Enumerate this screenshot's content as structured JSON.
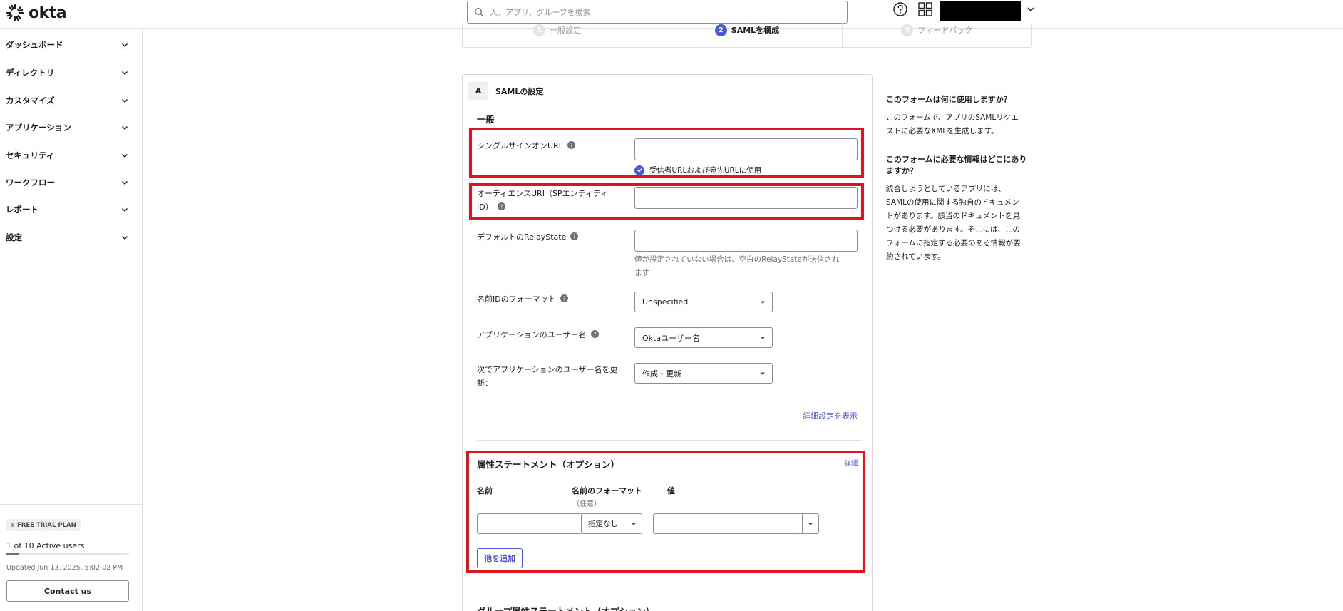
{
  "app": {
    "brand": "okta"
  },
  "search": {
    "placeholder": "人、アプリ、グループを検索"
  },
  "sidebar": {
    "items": [
      {
        "label": "ダッシュボード"
      },
      {
        "label": "ディレクトリ"
      },
      {
        "label": "カスタマイズ"
      },
      {
        "label": "アプリケーション"
      },
      {
        "label": "セキュリティ"
      },
      {
        "label": "ワークフロー"
      },
      {
        "label": "レポート"
      },
      {
        "label": "設定"
      }
    ],
    "footer": {
      "plan": "FREE TRIAL PLAN",
      "users": "1 of 10 Active users",
      "users_fraction": 0.1,
      "updated": "Updated Jun 13, 2025, 5:02:02 PM",
      "contact": "Contact us"
    }
  },
  "stepper": {
    "steps": [
      {
        "num": "1",
        "label": "一般設定"
      },
      {
        "num": "2",
        "label": "SAMLを構成"
      },
      {
        "num": "3",
        "label": "フィードバック"
      }
    ],
    "active_index": 1
  },
  "form": {
    "section_letter": "A",
    "section_title": "SAMLの設定",
    "general_heading": "一般",
    "sso_url_label": "シングルサインオンURL",
    "sso_url_value": "",
    "sso_checkbox_label": "受信者URLおよび宛先URLに使用",
    "sso_checkbox_checked": true,
    "audience_label_1": "オーディエンスURI（SPエンティティ",
    "audience_label_2": "ID）",
    "audience_value": "",
    "relay_label": "デフォルトのRelayState",
    "relay_value": "",
    "relay_help_1": "値が設定されていない場合は、空白のRelayStateが送信され",
    "relay_help_2": "ます",
    "nameid_label": "名前IDのフォーマット",
    "nameid_value": "Unspecified",
    "appuser_label": "アプリケーションのユーザー名",
    "appuser_value": "Oktaユーザー名",
    "update_label_1": "次でアプリケーションのユーザー名を更",
    "update_label_2": "新：",
    "update_value": "作成・更新",
    "advanced_link": "詳細設定を表示"
  },
  "attributes": {
    "title": "属性ステートメント（オプション）",
    "detail_link": "詳細",
    "col_name": "名前",
    "col_format": "名前のフォーマット",
    "col_format_sub": "（任意）",
    "col_value": "値",
    "format_value": "指定なし",
    "add_button": "他を追加"
  },
  "group_attributes": {
    "title": "グループ属性ステートメント（オプション）"
  },
  "aside": {
    "q1": "このフォームは何に使用しますか？",
    "a1_1": "このフォームで、アプリのSAMLリクエ",
    "a1_2": "ストに必要なXMLを生成します。",
    "q2_1": "このフォームに必要な情報はどこにあり",
    "q2_2": "ますか？",
    "a2_1": "統合しようとしているアプリには、",
    "a2_2": "SAMLの使用に関する独自のドキュメン",
    "a2_3": "トがあります。該当のドキュメントを見",
    "a2_4": "つける必要があります。そこには、この",
    "a2_5": "フォームに指定する必要のある情報が要",
    "a2_6": "約されています。"
  },
  "colors": {
    "accent": "#4b57d4",
    "highlight": "#e0141e"
  }
}
